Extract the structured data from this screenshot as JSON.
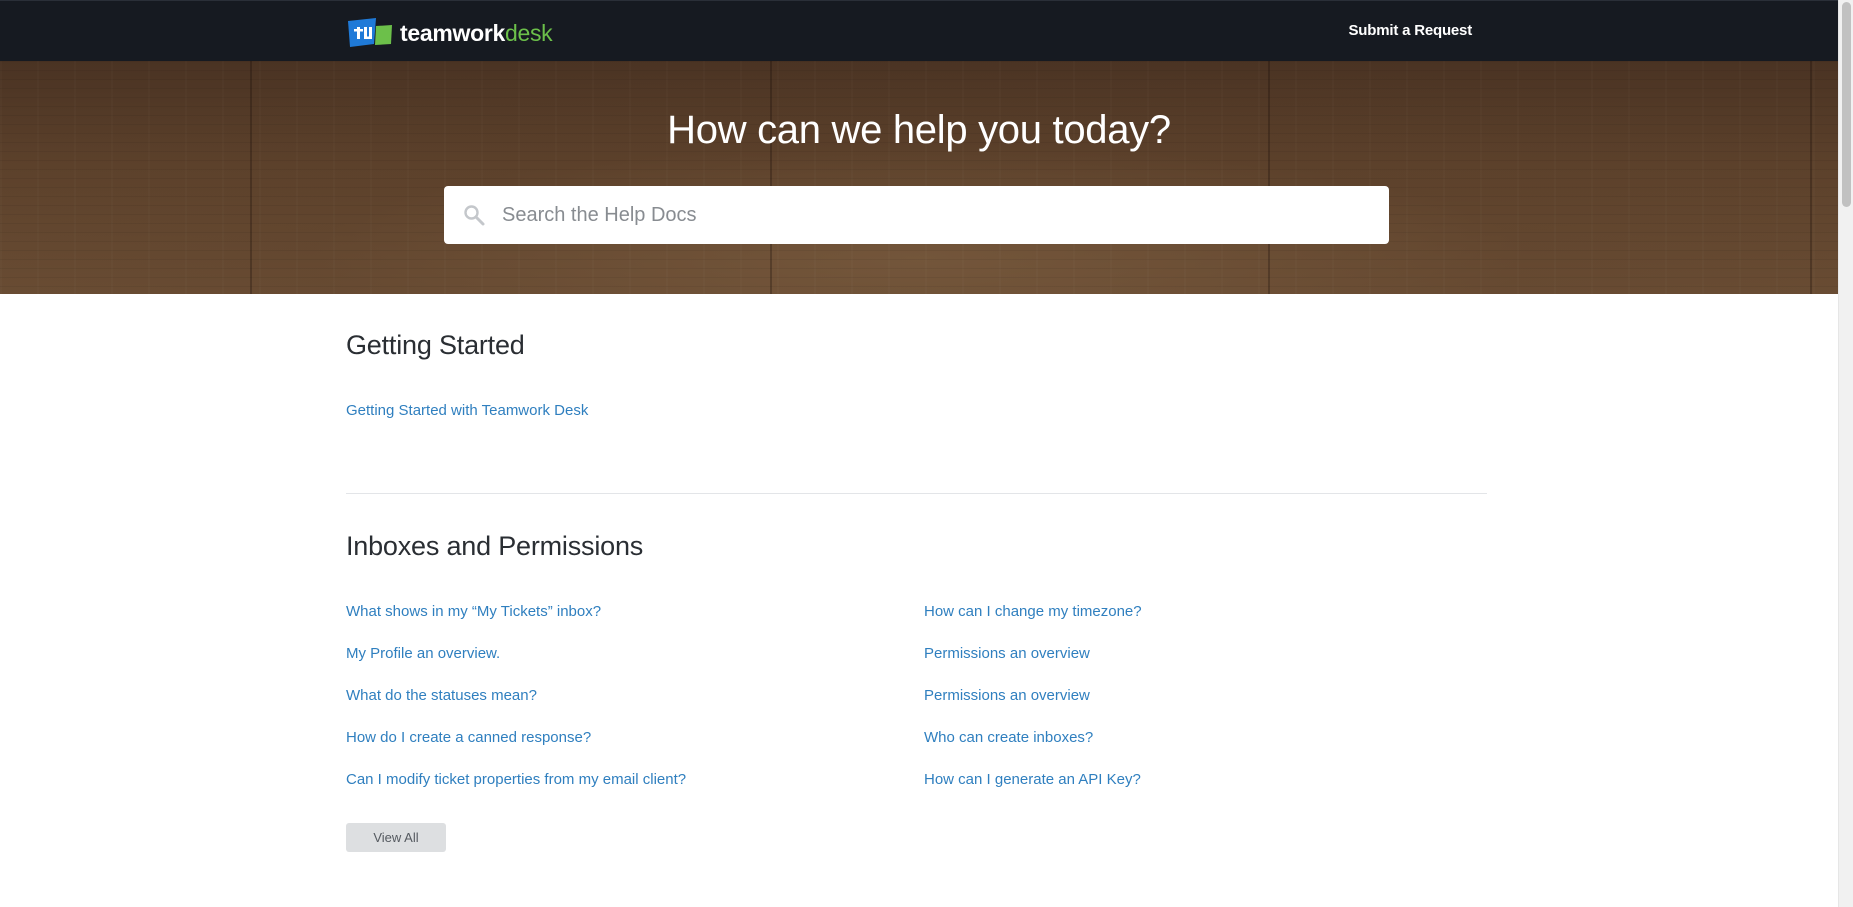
{
  "header": {
    "logo": {
      "text_main": "teamwork",
      "text_accent": "desk",
      "icon": "teamwork-desk-logo-icon",
      "colors": {
        "mark": "#1f7ad8",
        "accent": "#6cc04a"
      }
    },
    "submit_request_label": "Submit a Request"
  },
  "hero": {
    "title": "How can we help you today?",
    "search": {
      "placeholder": "Search the Help Docs",
      "icon": "search-icon"
    }
  },
  "sections": {
    "getting_started": {
      "heading": "Getting Started",
      "articles": [
        "Getting Started with Teamwork Desk"
      ]
    },
    "inboxes_permissions": {
      "heading": "Inboxes and Permissions",
      "left_articles": [
        "What shows in my “My Tickets” inbox?",
        "My Profile an overview.",
        "What do the statuses mean?",
        "How do I create a canned response?",
        "Can I modify ticket properties from my email client?"
      ],
      "right_articles": [
        "How can I change my timezone?",
        "Permissions an overview",
        "Permissions an overview",
        "Who can create inboxes?",
        "How can I generate an API Key?"
      ],
      "view_all_label": "View All"
    }
  },
  "colors": {
    "navbar": "#161a21",
    "link": "#2f7fbf",
    "heading": "#2a2e33",
    "button_bg": "#dddfe1"
  }
}
